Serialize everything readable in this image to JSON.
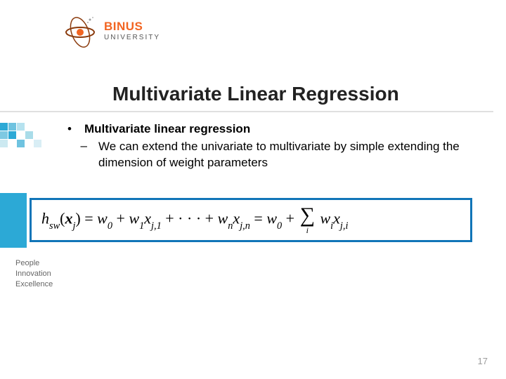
{
  "logo": {
    "brand": "BINUS",
    "sub": "UNIVERSITY"
  },
  "title": "Multivariate Linear Regression",
  "bullet": {
    "label": "Multivariate linear regression"
  },
  "subbullet": "We can extend the univariate to multivariate by simple extending the dimension of weight parameters",
  "equation": {
    "lhs_func": "h",
    "lhs_sub": "sw",
    "lhs_arg_var": "x",
    "lhs_arg_sub": "j",
    "rhs_terms": [
      {
        "coef": "w",
        "coefsub": "0"
      },
      {
        "coef": "w",
        "coefsub": "1",
        "var": "x",
        "varsub": "j,1"
      }
    ],
    "dots": "· · ·",
    "last": {
      "coef": "w",
      "coefsub": "n",
      "var": "x",
      "varsub": "j,n"
    },
    "sum_leading": {
      "coef": "w",
      "coefsub": "0"
    },
    "sum_index": "i",
    "sum_term": {
      "coef": "w",
      "coefsub": "i",
      "var": "x",
      "varsub": "j,i"
    }
  },
  "tagline": {
    "l1": "People",
    "l2": "Innovation",
    "l3": "Excellence"
  },
  "page": "17",
  "colors": {
    "accent": "#1175b8",
    "brand_orange": "#f26522",
    "band": "#2ca9d6"
  }
}
